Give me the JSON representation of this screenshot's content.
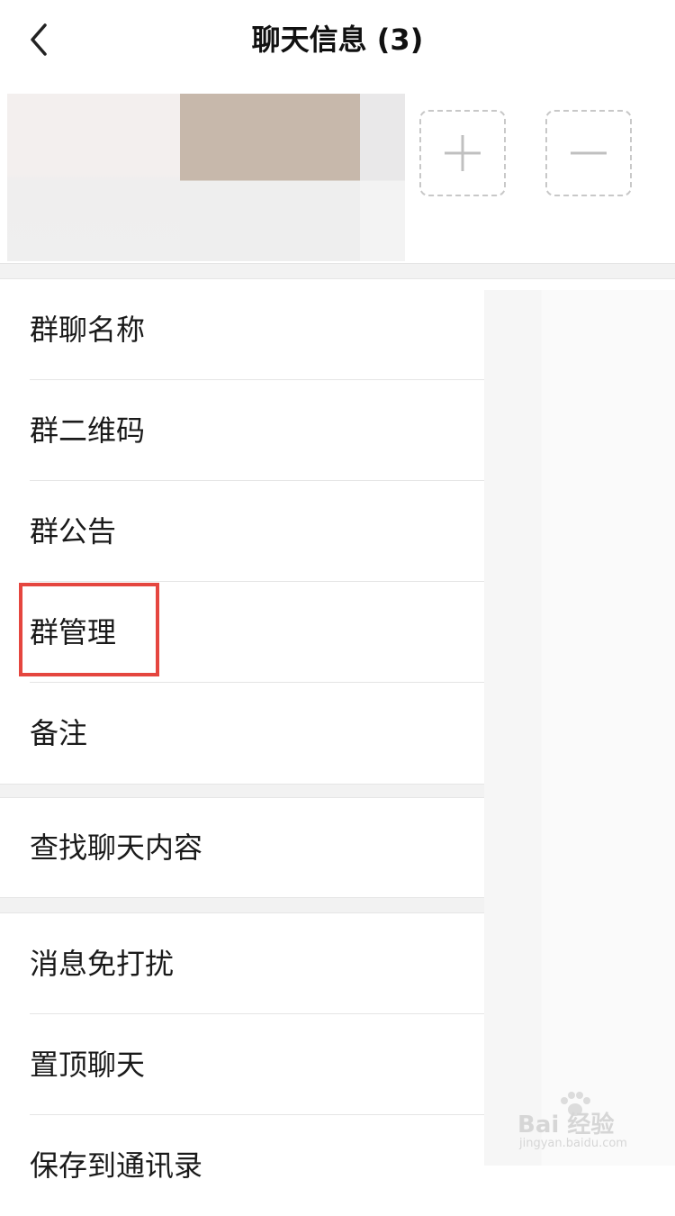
{
  "header": {
    "title": "聊天信息 (3)",
    "back_icon": "chevron-left-icon"
  },
  "members": {
    "add_icon": "plus-icon",
    "remove_icon": "minus-icon"
  },
  "sections": [
    {
      "items": [
        {
          "label": "群聊名称"
        },
        {
          "label": "群二维码"
        },
        {
          "label": "群公告"
        },
        {
          "label": "群管理"
        },
        {
          "label": "备注"
        }
      ]
    },
    {
      "items": [
        {
          "label": "查找聊天内容"
        }
      ]
    },
    {
      "items": [
        {
          "label": "消息免打扰"
        },
        {
          "label": "置顶聊天"
        },
        {
          "label": "保存到通讯录"
        }
      ]
    }
  ],
  "highlight": {
    "target": "群管理",
    "color": "#e5463f"
  },
  "watermark": {
    "brand": "Bai 经验",
    "url": "jingyan.baidu.com"
  }
}
